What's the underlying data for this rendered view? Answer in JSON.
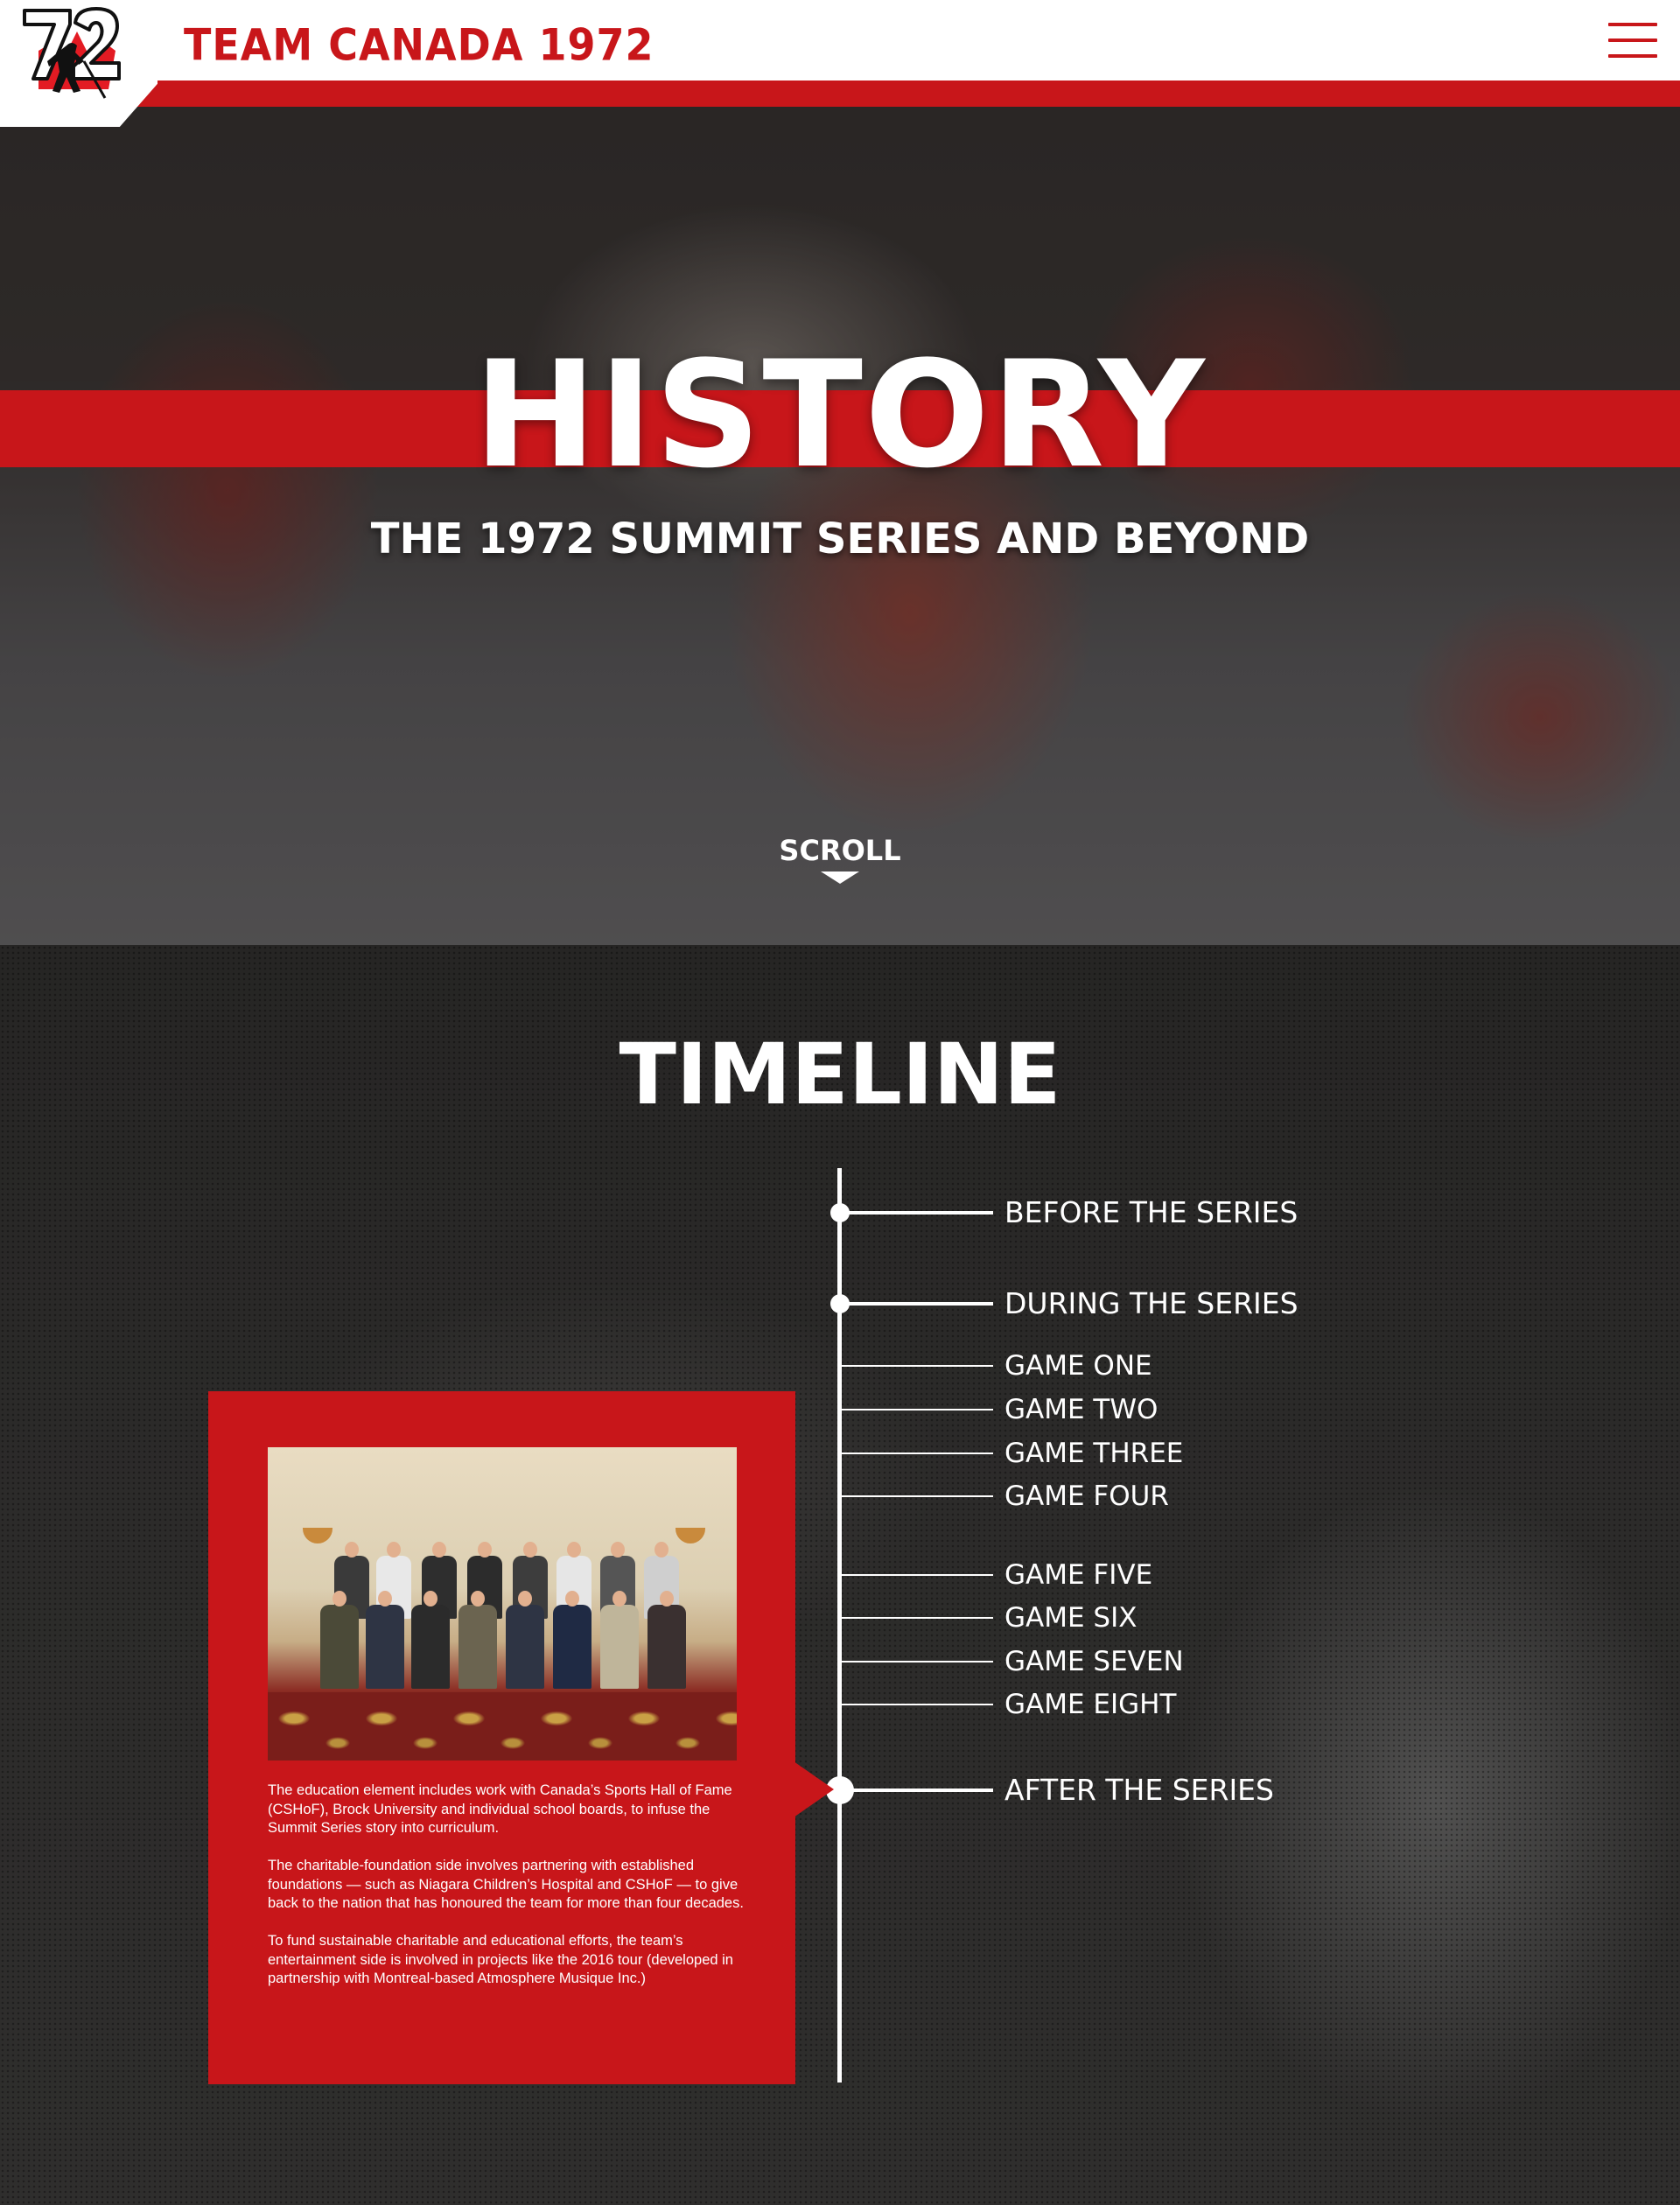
{
  "header": {
    "logo_text": "72",
    "brand": "TEAM CANADA 1972",
    "menu_icon": "hamburger-icon"
  },
  "hero": {
    "title": "HISTORY",
    "subtitle": "THE 1972 SUMMIT SERIES AND BEYOND",
    "scroll_label": "SCROLL",
    "scroll_icon": "triangle-down-icon"
  },
  "timeline": {
    "heading": "TIMELINE",
    "items": [
      {
        "label": "BEFORE THE SERIES",
        "kind": "major"
      },
      {
        "label": "DURING THE SERIES",
        "kind": "major"
      },
      {
        "label": "GAME ONE",
        "kind": "minor"
      },
      {
        "label": "GAME TWO",
        "kind": "minor"
      },
      {
        "label": "GAME THREE",
        "kind": "minor"
      },
      {
        "label": "GAME FOUR",
        "kind": "minor"
      },
      {
        "label": "GAME FIVE",
        "kind": "minor"
      },
      {
        "label": "GAME SIX",
        "kind": "minor"
      },
      {
        "label": "GAME SEVEN",
        "kind": "minor"
      },
      {
        "label": "GAME EIGHT",
        "kind": "minor"
      },
      {
        "label": "AFTER THE SERIES",
        "kind": "major",
        "active": true
      }
    ],
    "card": {
      "paragraphs": [
        "The education element includes work with Canada’s Sports Hall of Fame (CSHoF), Brock University and individual school boards, to infuse the Summit Series story into curriculum.",
        "The charitable-foundation side involves partnering with established foundations — such as Niagara Children’s Hospital and CSHoF — to give back to the nation that has honoured the team for more than four decades.",
        "To fund sustainable charitable and educational efforts, the team’s entertainment side is involved in projects like the 2016 tour (developed in partnership with Montreal-based Atmosphere Musique Inc.)"
      ]
    }
  },
  "colors": {
    "brand_red": "#c8161a",
    "white": "#ffffff",
    "dark_bg": "#2a2928"
  }
}
